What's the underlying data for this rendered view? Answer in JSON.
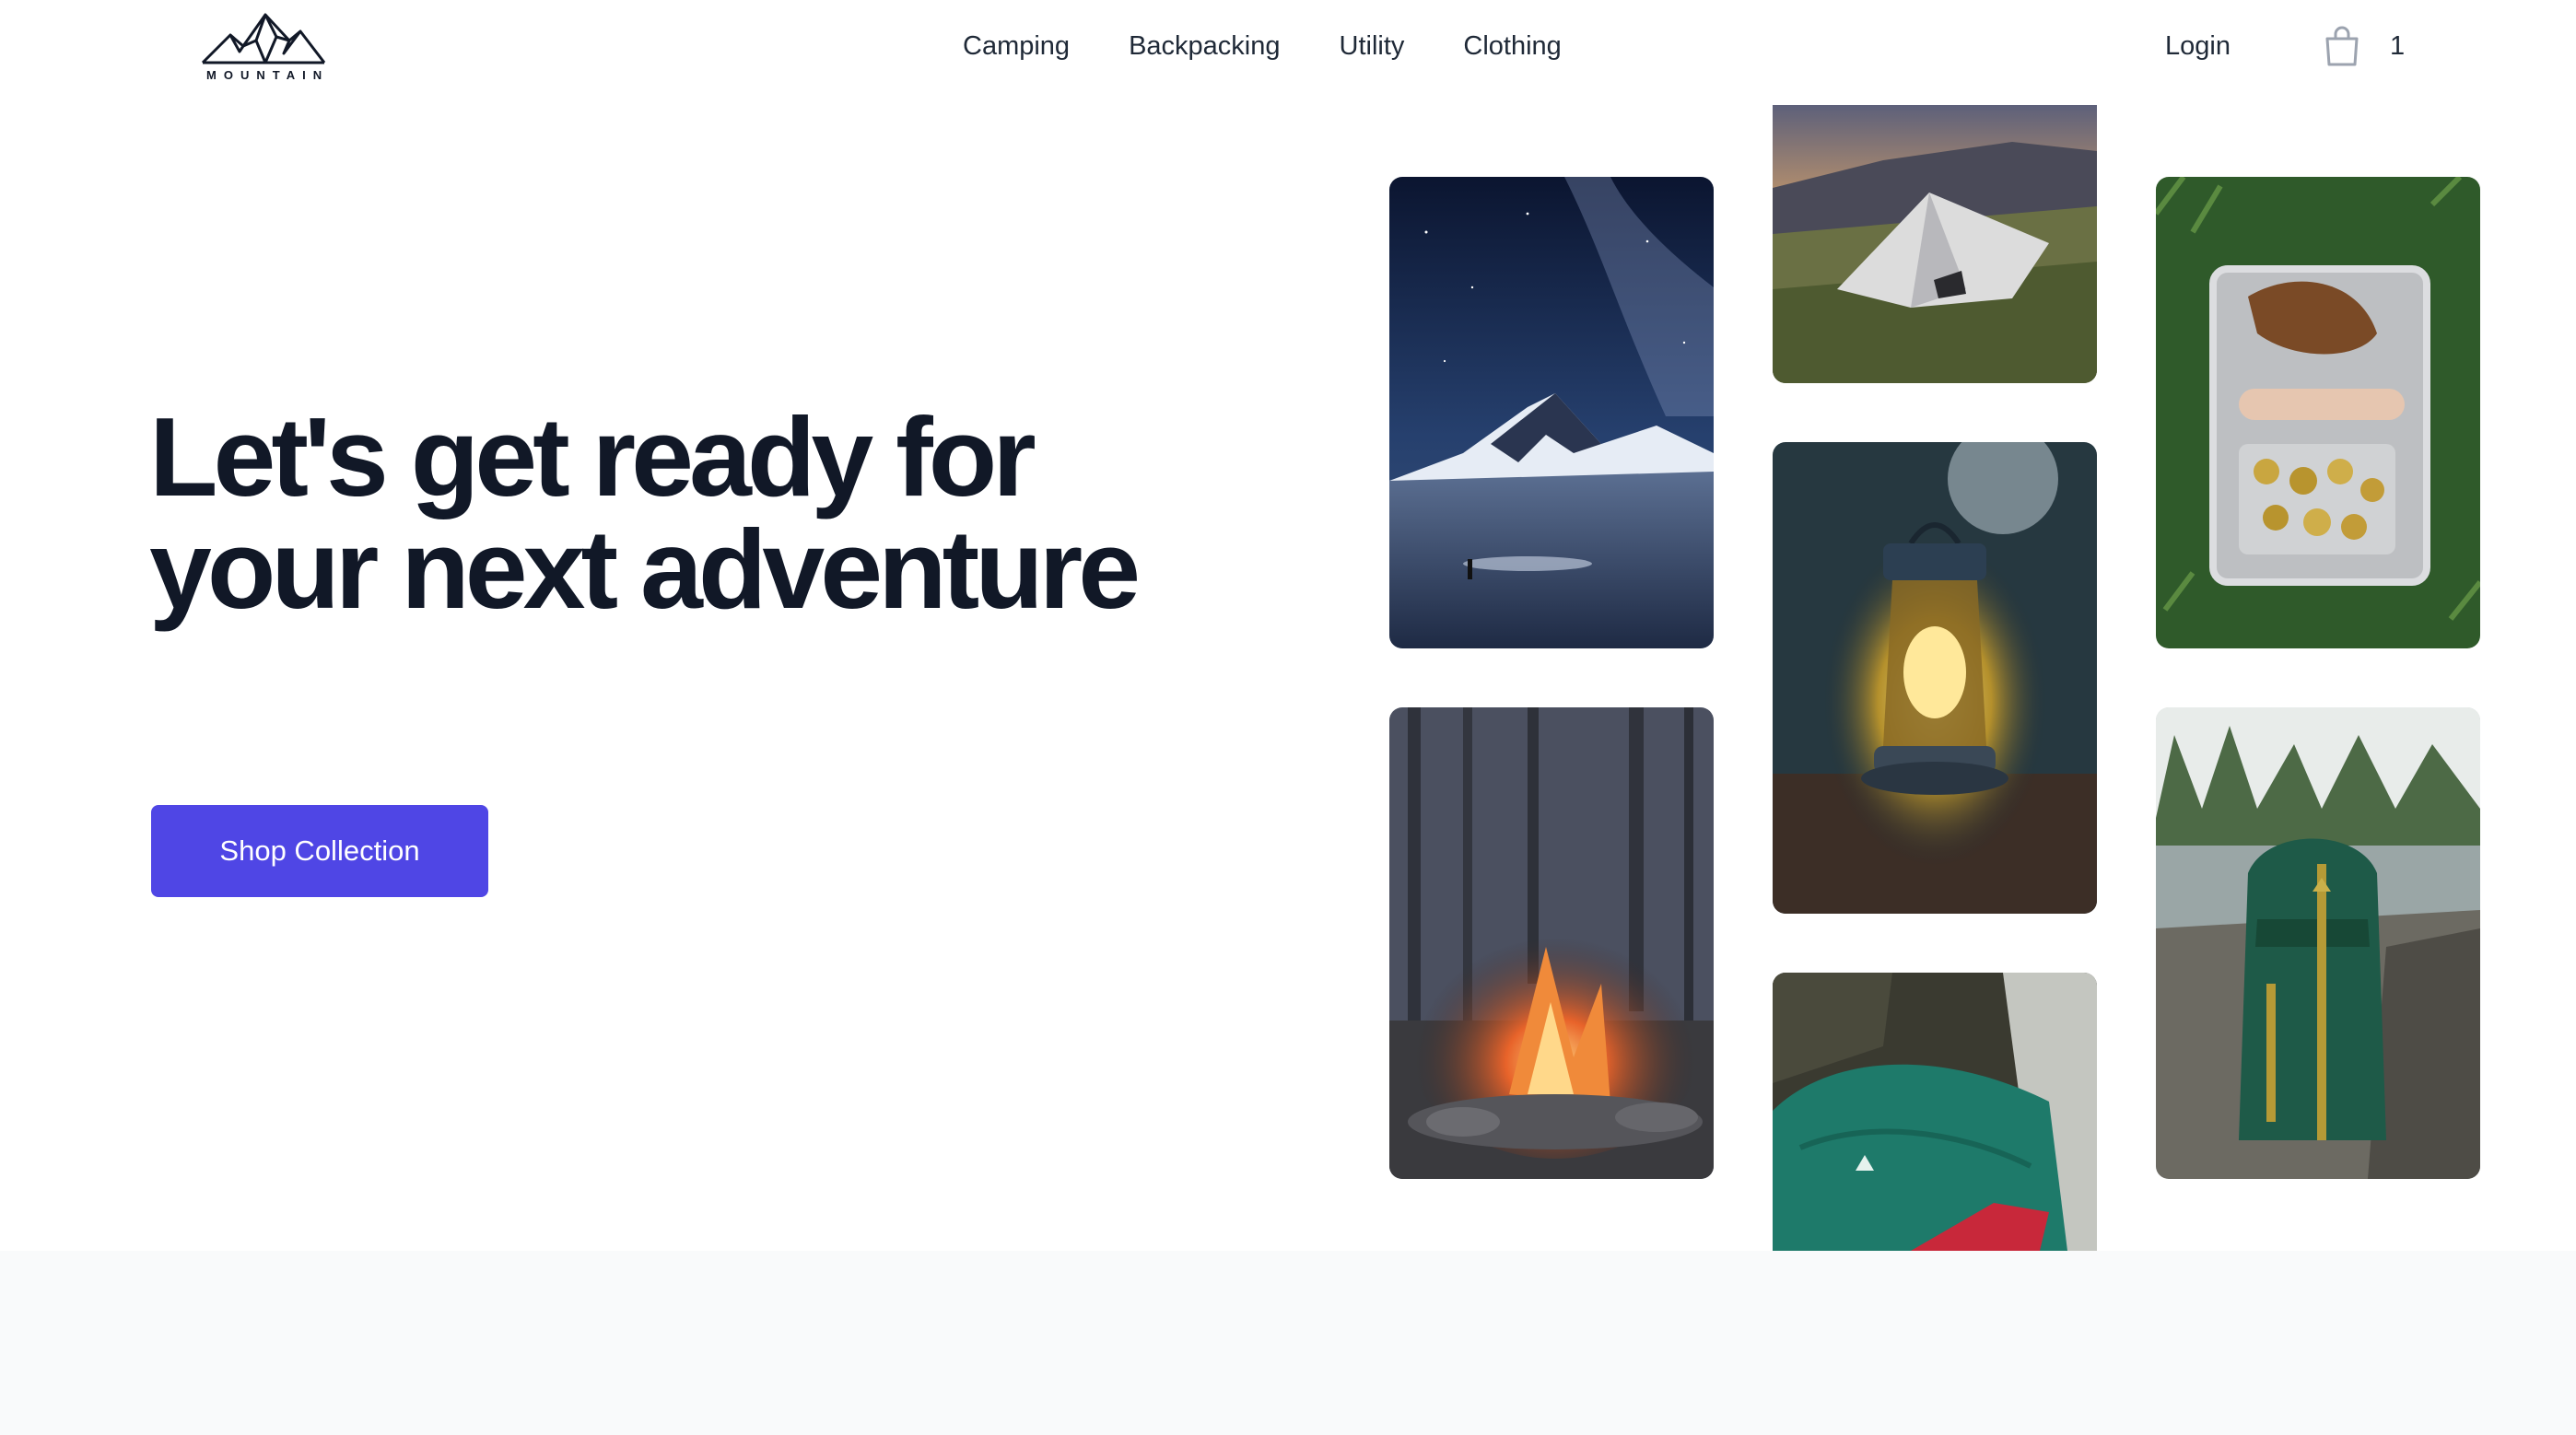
{
  "brand": {
    "logo_text": "MOUNTAIN",
    "logo_icon": "mountain-logo-icon"
  },
  "nav": {
    "items": [
      {
        "label": "Camping"
      },
      {
        "label": "Backpacking"
      },
      {
        "label": "Utility"
      },
      {
        "label": "Clothing"
      }
    ]
  },
  "header": {
    "login_label": "Login",
    "cart_icon": "shopping-bag-icon",
    "cart_count": "1"
  },
  "hero": {
    "title": "Let's get ready for your next adventure",
    "cta_label": "Shop Collection"
  },
  "colors": {
    "accent": "#4f46e5",
    "heading": "#111827",
    "nav_text": "#1f2937",
    "footer_bg": "#f9fafb"
  }
}
